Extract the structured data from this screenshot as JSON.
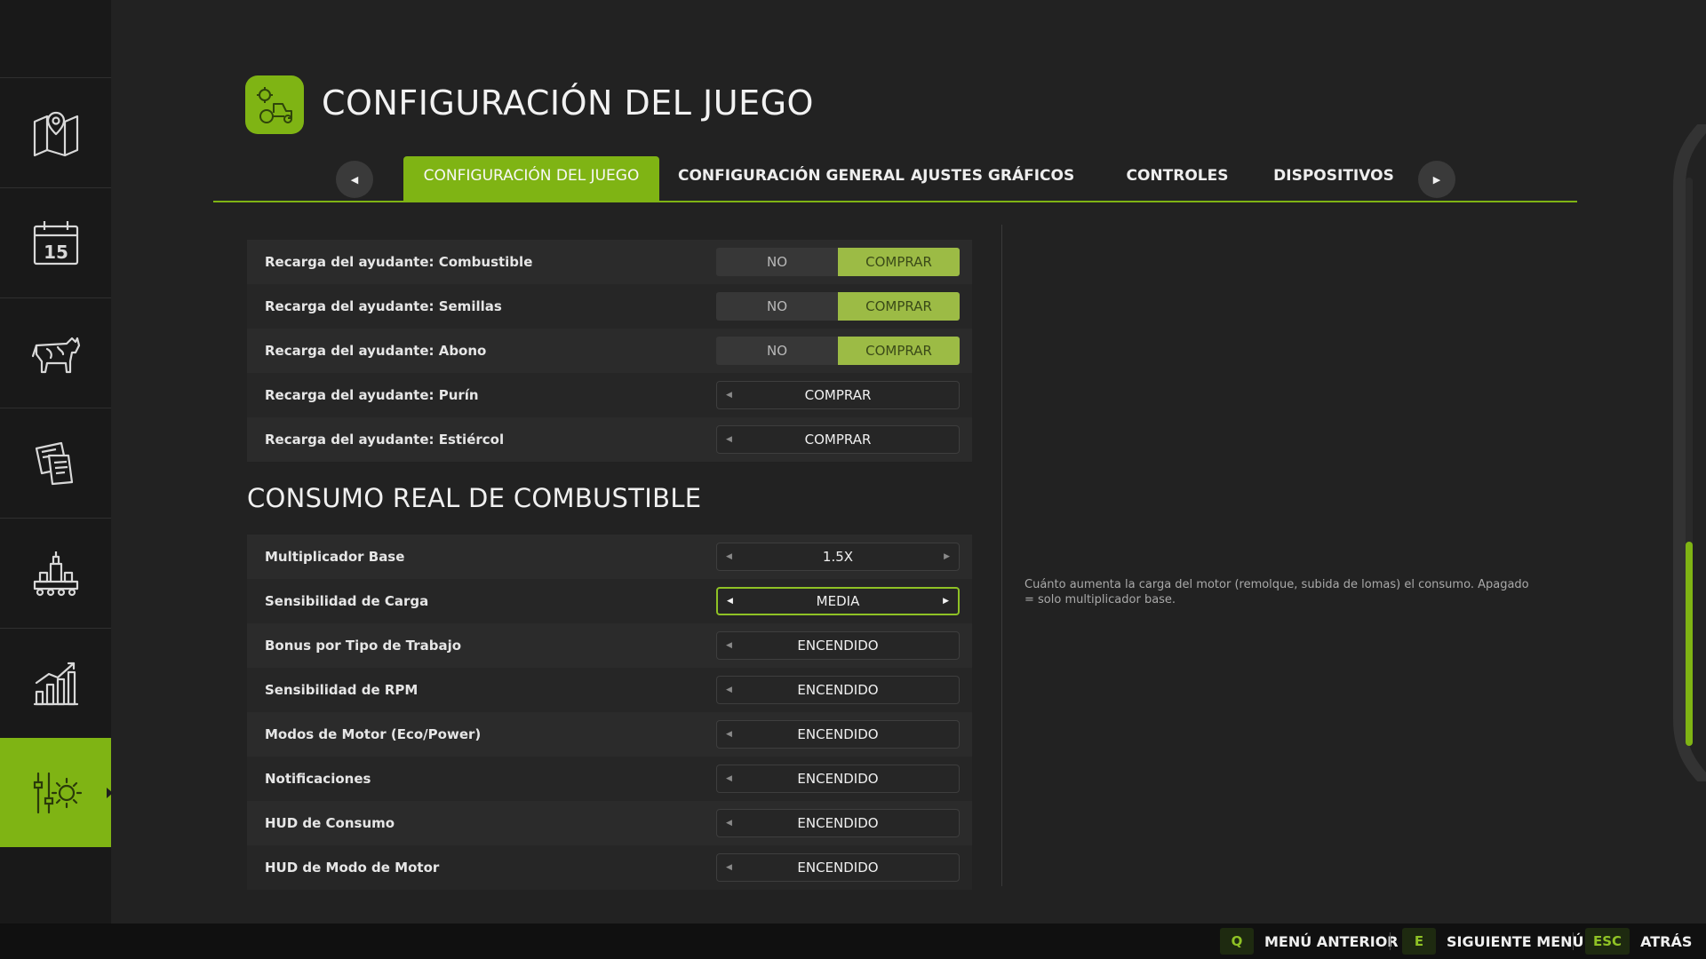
{
  "header": {
    "title": "CONFIGURACIÓN DEL JUEGO",
    "icon": "tractor-gear-icon"
  },
  "sidebar": {
    "items": [
      {
        "icon": "map-icon",
        "active": false
      },
      {
        "icon": "calendar-icon",
        "active": false,
        "day": "15"
      },
      {
        "icon": "cow-icon",
        "active": false
      },
      {
        "icon": "contracts-icon",
        "active": false
      },
      {
        "icon": "production-icon",
        "active": false
      },
      {
        "icon": "statistics-icon",
        "active": false
      },
      {
        "icon": "settings-icon",
        "active": true
      }
    ]
  },
  "tabs": {
    "items": [
      {
        "label": "CONFIGURACIÓN DEL JUEGO",
        "active": true
      },
      {
        "label": "CONFIGURACIÓN GENERAL",
        "active": false
      },
      {
        "label": "AJUSTES GRÁFICOS",
        "active": false
      },
      {
        "label": "CONTROLES",
        "active": false
      },
      {
        "label": "DISPOSITIVOS",
        "active": false
      }
    ]
  },
  "helper_refill": {
    "rows": [
      {
        "label": "Recarga del ayudante: Combustible",
        "type": "toggle",
        "no": "NO",
        "yes": "COMPRAR"
      },
      {
        "label": "Recarga del ayudante: Semillas",
        "type": "toggle",
        "no": "NO",
        "yes": "COMPRAR"
      },
      {
        "label": "Recarga del ayudante: Abono",
        "type": "toggle",
        "no": "NO",
        "yes": "COMPRAR"
      },
      {
        "label": "Recarga del ayudante: Purín",
        "type": "select",
        "value": "COMPRAR"
      },
      {
        "label": "Recarga del ayudante: Estiércol",
        "type": "select",
        "value": "COMPRAR"
      }
    ]
  },
  "fuel_section": {
    "title": "CONSUMO REAL DE COMBUSTIBLE",
    "rows": [
      {
        "label": "Multiplicador Base",
        "value": "1.5X"
      },
      {
        "label": "Sensibilidad de Carga",
        "value": "MEDIA",
        "focused": true
      },
      {
        "label": "Bonus por Tipo de Trabajo",
        "value": "ENCENDIDO"
      },
      {
        "label": "Sensibilidad de RPM",
        "value": "ENCENDIDO"
      },
      {
        "label": "Modos de Motor (Eco/Power)",
        "value": "ENCENDIDO"
      },
      {
        "label": "Notificaciones",
        "value": "ENCENDIDO"
      },
      {
        "label": "HUD de Consumo",
        "value": "ENCENDIDO"
      },
      {
        "label": "HUD de Modo de Motor",
        "value": "ENCENDIDO"
      }
    ]
  },
  "description": "Cuánto aumenta la carga del motor (remolque, subida de lomas) el consumo. Apagado = solo multiplicador base.",
  "footer": {
    "hints": [
      {
        "key": "Q",
        "label": "MENÚ ANTERIOR"
      },
      {
        "key": "E",
        "label": "SIGUIENTE MENÚ"
      },
      {
        "key": "ESC",
        "label": "ATRÁS"
      }
    ]
  },
  "colors": {
    "accent": "#7fb414",
    "background": "#222222",
    "sidebar": "#191919",
    "toggle_on": "#9cbb45"
  }
}
